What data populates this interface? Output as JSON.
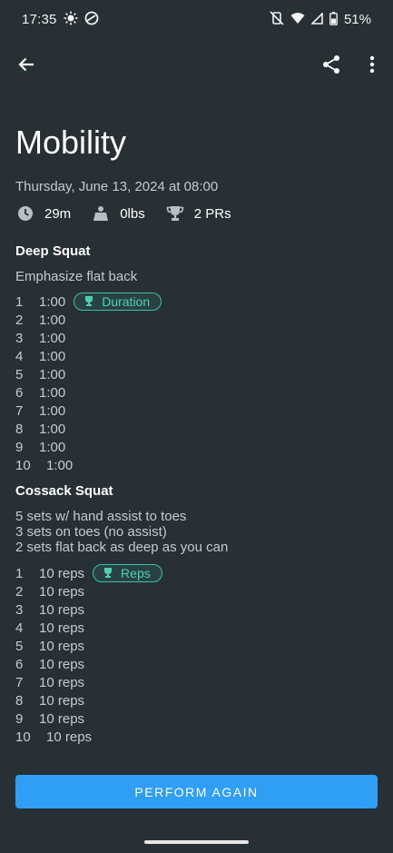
{
  "status_bar": {
    "time": "17:35",
    "battery": "51%",
    "icons": [
      "brightness-icon",
      "vpn-icon",
      "mute-icon",
      "wifi-icon",
      "signal-icon",
      "battery-icon"
    ]
  },
  "appbar": {
    "back_icon": "arrow-back-icon",
    "share_icon": "share-icon",
    "more_icon": "more-vert-icon"
  },
  "workout": {
    "title": "Mobility",
    "date": "Thursday, June 13, 2024 at 08:00",
    "stats": {
      "duration": "29m",
      "weight": "0lbs",
      "prs": "2 PRs"
    }
  },
  "exercises": [
    {
      "name": "Deep Squat",
      "note_lines": [
        "Emphasize flat back"
      ],
      "sets": [
        {
          "num": "1",
          "value": "1:00",
          "pr": "Duration"
        },
        {
          "num": "2",
          "value": "1:00"
        },
        {
          "num": "3",
          "value": "1:00"
        },
        {
          "num": "4",
          "value": "1:00"
        },
        {
          "num": "5",
          "value": "1:00"
        },
        {
          "num": "6",
          "value": "1:00"
        },
        {
          "num": "7",
          "value": "1:00"
        },
        {
          "num": "8",
          "value": "1:00"
        },
        {
          "num": "9",
          "value": "1:00"
        },
        {
          "num": "10",
          "value": "1:00"
        }
      ]
    },
    {
      "name": "Cossack Squat",
      "note_lines": [
        "5 sets w/ hand assist to toes",
        "3 sets on toes (no assist)",
        "2 sets flat back as deep as you can"
      ],
      "sets": [
        {
          "num": "1",
          "value": "10 reps",
          "pr": "Reps"
        },
        {
          "num": "2",
          "value": "10 reps"
        },
        {
          "num": "3",
          "value": "10 reps"
        },
        {
          "num": "4",
          "value": "10 reps"
        },
        {
          "num": "5",
          "value": "10 reps"
        },
        {
          "num": "6",
          "value": "10 reps"
        },
        {
          "num": "7",
          "value": "10 reps"
        },
        {
          "num": "8",
          "value": "10 reps"
        },
        {
          "num": "9",
          "value": "10 reps"
        },
        {
          "num": "10",
          "value": "10 reps"
        }
      ]
    }
  ],
  "actions": {
    "perform_again": "PERFORM AGAIN"
  },
  "colors": {
    "background": "#273035",
    "accent": "#2f9ef5",
    "pr_badge": "#3dbfa9"
  }
}
